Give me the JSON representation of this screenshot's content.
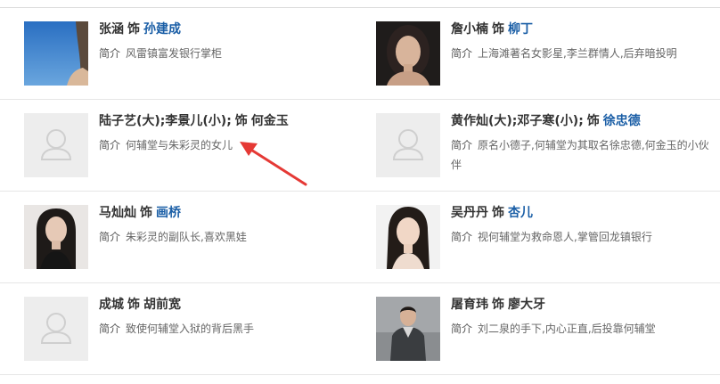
{
  "cast": [
    {
      "actor": "张涵",
      "verb": "饰",
      "role": "孙建成",
      "role_linked": true,
      "desc_label": "简介",
      "desc": "风雷镇富发银行掌柜",
      "photo": "actor-photo-blue-sky"
    },
    {
      "actor": "詹小楠",
      "verb": "饰",
      "role": "柳丁",
      "role_linked": true,
      "desc_label": "简介",
      "desc": "上海滩著名女影星,李兰群情人,后弃暗投明",
      "photo": "actress-portrait"
    },
    {
      "actor": "陆子艺(大);李景儿(小);",
      "verb": "饰",
      "role": "何金玉",
      "role_linked": false,
      "desc_label": "简介",
      "desc": "何辅堂与朱彩灵的女儿",
      "photo": "placeholder-avatar"
    },
    {
      "actor": "黄作灿(大);邓子寒(小);",
      "verb": "饰",
      "role": "徐忠德",
      "role_linked": true,
      "desc_label": "简介",
      "desc": "原名小德子,何辅堂为其取名徐忠德,何金玉的小伙伴",
      "photo": "placeholder-avatar"
    },
    {
      "actor": "马灿灿",
      "verb": "饰",
      "role": "画桥",
      "role_linked": true,
      "desc_label": "简介",
      "desc": "朱彩灵的副队长,喜欢黑娃",
      "photo": "actress-portrait"
    },
    {
      "actor": "吴丹丹",
      "verb": "饰",
      "role": "杏儿",
      "role_linked": true,
      "desc_label": "简介",
      "desc": "视何辅堂为救命恩人,掌管回龙镇银行",
      "photo": "actress-portrait"
    },
    {
      "actor": "成城",
      "verb": "饰",
      "role": "胡前宽",
      "role_linked": false,
      "desc_label": "简介",
      "desc": "致使何辅堂入狱的背后黑手",
      "photo": "placeholder-avatar"
    },
    {
      "actor": "屠育玮",
      "verb": "饰",
      "role": "廖大牙",
      "role_linked": false,
      "desc_label": "简介",
      "desc": "刘二泉的手下,内心正直,后投靠何辅堂",
      "photo": "actor-portrait"
    }
  ],
  "colors": {
    "role_link": "#1a5ea6",
    "arrow": "#e53935"
  }
}
